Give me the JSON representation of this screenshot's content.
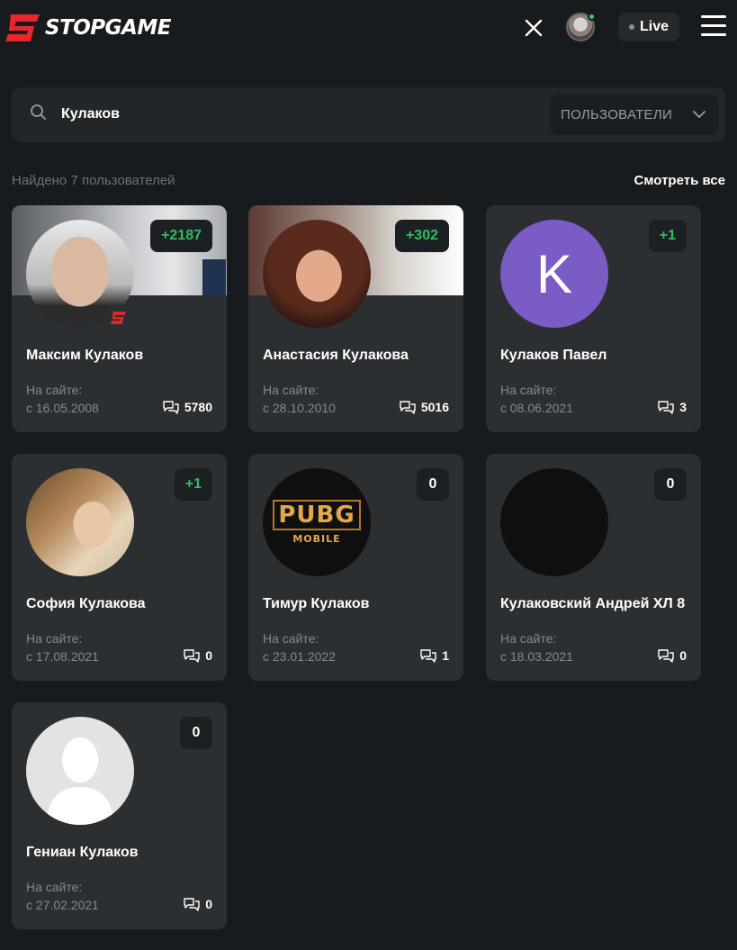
{
  "header": {
    "logo_text": "STOPGAME",
    "live_label": "Live"
  },
  "search": {
    "query": "Кулаков",
    "filter_label": "ПОЛЬЗОВАТЕЛИ"
  },
  "results": {
    "found_text": "Найдено 7 пользователей",
    "see_all": "Смотреть все"
  },
  "since_label": "На сайте:",
  "colors": {
    "accent_positive": "#2fbd64",
    "brand_red": "#e8262c",
    "card_bg": "#2c2f31"
  },
  "users": [
    {
      "name": "Максим Кулаков",
      "rating": "+2187",
      "since": "с 16.05.2008",
      "comments": "5780",
      "avatar": "photo-man"
    },
    {
      "name": "Анастасия Кулакова",
      "rating": "+302",
      "since": "с 28.10.2010",
      "comments": "5016",
      "avatar": "photo-woman"
    },
    {
      "name": "Кулаков Павел",
      "rating": "+1",
      "since": "с 08.06.2021",
      "comments": "3",
      "avatar_letter": "K"
    },
    {
      "name": "София Кулакова",
      "rating": "+1",
      "since": "с 17.08.2021",
      "comments": "0",
      "avatar": "photo-woman-2"
    },
    {
      "name": "Тимур Кулаков",
      "rating": "0",
      "since": "с 23.01.2022",
      "comments": "1",
      "avatar_text": [
        "PUBG",
        "MOBILE"
      ]
    },
    {
      "name": "Кулаковский Андрей ХЛ 8",
      "rating": "0",
      "since": "с 18.03.2021",
      "comments": "0",
      "avatar": "dark"
    },
    {
      "name": "Гениан Кулаков",
      "rating": "0",
      "since": "с 27.02.2021",
      "comments": "0",
      "avatar": "default-silhouette"
    }
  ]
}
